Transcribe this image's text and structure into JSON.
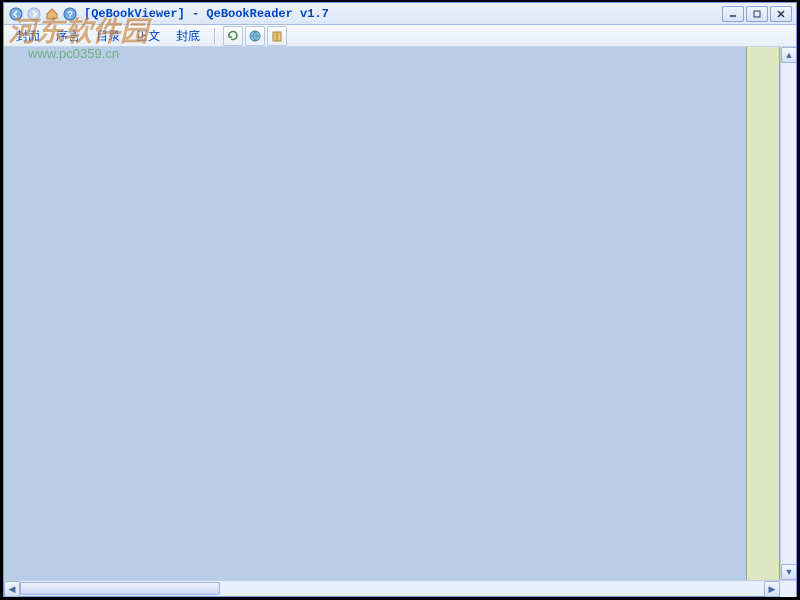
{
  "window": {
    "title": "[QeBookViewer] - QeBookReader v1.7"
  },
  "menu": {
    "items": [
      "封面",
      "序言",
      "目录",
      "正文",
      "封底"
    ]
  },
  "toolbar": {
    "icons": [
      "refresh-icon",
      "globe-icon",
      "book-icon"
    ]
  },
  "watermark": {
    "text": "河东软件园",
    "url": "www.pc0359.cn"
  }
}
